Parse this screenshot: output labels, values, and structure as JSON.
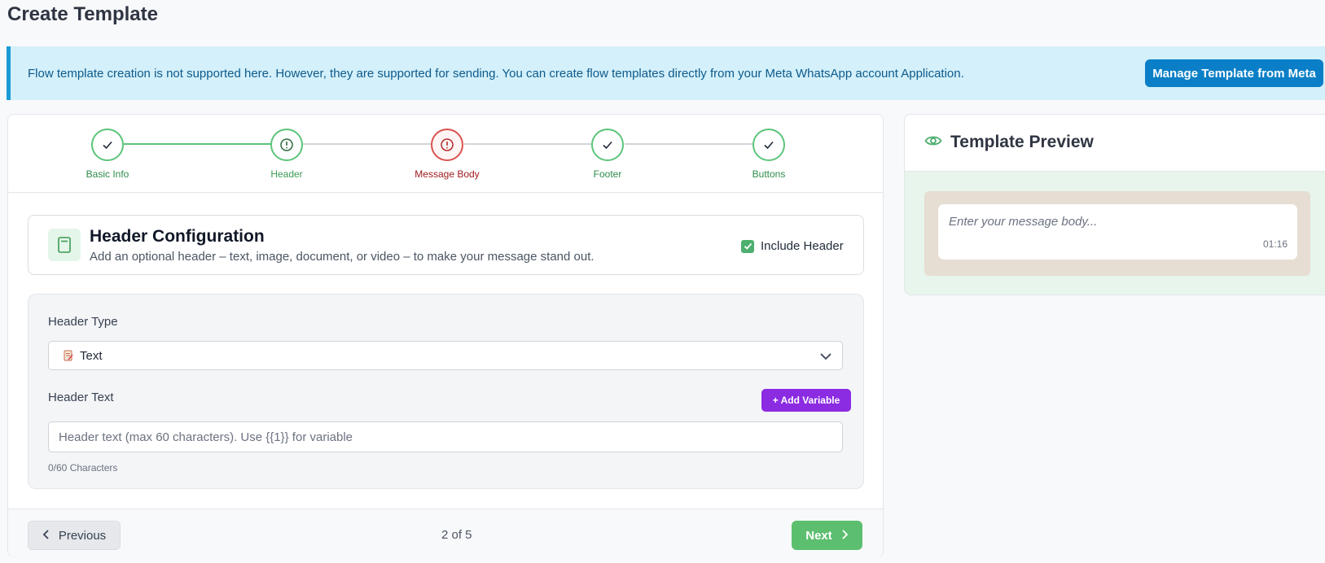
{
  "page": {
    "title": "Create Template"
  },
  "banner": {
    "text": "Flow template creation is not supported here. However, they are supported for sending. You can create flow templates directly from your Meta WhatsApp account Application.",
    "button_label": "Manage Template from Meta"
  },
  "stepper": {
    "steps": [
      {
        "label": "Basic Info",
        "state": "complete",
        "icon": "check-icon"
      },
      {
        "label": "Header",
        "state": "current",
        "icon": "alert-circle-icon"
      },
      {
        "label": "Message Body",
        "state": "error",
        "icon": "alert-circle-icon"
      },
      {
        "label": "Footer",
        "state": "complete",
        "icon": "check-icon"
      },
      {
        "label": "Buttons",
        "state": "complete",
        "icon": "check-icon"
      }
    ]
  },
  "header_config": {
    "title": "Header Configuration",
    "subtitle": "Add an optional header – text, image, document, or video – to make your message stand out.",
    "include_label": "Include Header",
    "include_checked": true,
    "icon": "document-icon"
  },
  "form": {
    "header_type_label": "Header Type",
    "header_type_value": "Text",
    "header_text_label": "Header Text",
    "add_variable_label": "+ Add Variable",
    "header_text_placeholder": "Header text (max 60 characters). Use {{1}} for variable",
    "header_text_value": "",
    "char_count": "0/60 Characters"
  },
  "nav": {
    "previous_label": "Previous",
    "page_indicator": "2 of 5",
    "next_label": "Next"
  },
  "preview": {
    "title": "Template Preview",
    "message_placeholder": "Enter your message body...",
    "time": "01:16"
  },
  "colors": {
    "accent_green": "#5cc47a",
    "error_red": "#d9534f",
    "primary_blue": "#0a7fc7",
    "variable_purple": "#8b2be2"
  }
}
